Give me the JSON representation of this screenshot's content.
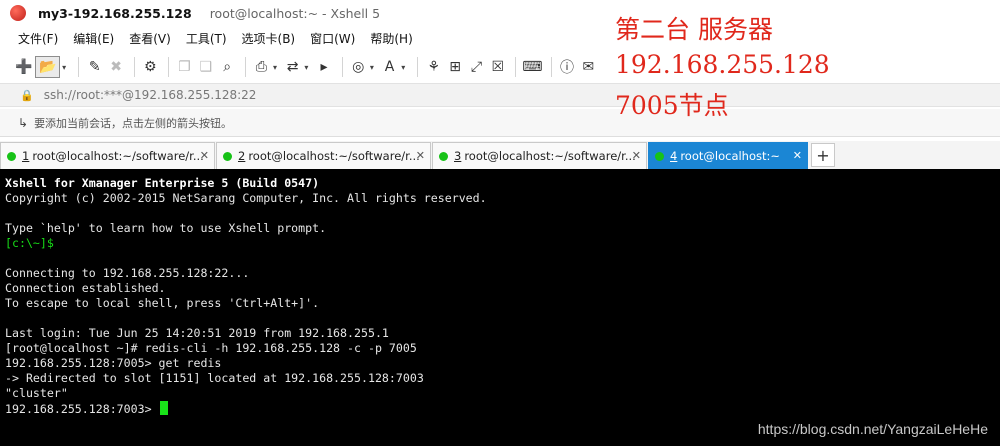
{
  "window": {
    "session_title": "my3-192.168.255.128",
    "title_rest": "root@localhost:~ - Xshell 5"
  },
  "menu": [
    "文件(F)",
    "编辑(E)",
    "查看(V)",
    "工具(T)",
    "选项卡(B)",
    "窗口(W)",
    "帮助(H)"
  ],
  "toolbar": {
    "icons": [
      "new-session-icon",
      "open-folder-icon",
      "disconnect-icon",
      "reconnect-icon",
      "properties-icon",
      "copy-icon",
      "paste-icon",
      "find-icon",
      "print-icon",
      "transfer-icon",
      "script-icon",
      "globe-icon",
      "font-icon",
      "xftp-icon",
      "tile-icon",
      "fullscreen-icon",
      "lock-icon",
      "keyboard-icon",
      "help-icon",
      "chat-icon"
    ]
  },
  "address": {
    "url": "ssh://root:***@192.168.255.128:22"
  },
  "hint": {
    "text": "要添加当前会话，点击左侧的箭头按钮。"
  },
  "tabs": [
    {
      "num": "1",
      "label": "root@localhost:~/software/r...",
      "active": false
    },
    {
      "num": "2",
      "label": "root@localhost:~/software/r...",
      "active": false
    },
    {
      "num": "3",
      "label": "root@localhost:~/software/r...",
      "active": false
    },
    {
      "num": "4",
      "label": "root@localhost:~",
      "active": true
    }
  ],
  "terminal": {
    "lines": [
      {
        "text": "Xshell for Xmanager Enterprise 5 (Build 0547)",
        "style": "bold"
      },
      {
        "text": "Copyright (c) 2002-2015 NetSarang Computer, Inc. All rights reserved.",
        "style": ""
      },
      {
        "text": "",
        "style": ""
      },
      {
        "text": "Type `help' to learn how to use Xshell prompt.",
        "style": ""
      },
      {
        "text": "[c:\\~]$",
        "style": "green"
      },
      {
        "text": "",
        "style": ""
      },
      {
        "text": "Connecting to 192.168.255.128:22...",
        "style": ""
      },
      {
        "text": "Connection established.",
        "style": ""
      },
      {
        "text": "To escape to local shell, press 'Ctrl+Alt+]'.",
        "style": ""
      },
      {
        "text": "",
        "style": ""
      },
      {
        "text": "Last login: Tue Jun 25 14:20:51 2019 from 192.168.255.1",
        "style": ""
      },
      {
        "text": "[root@localhost ~]# redis-cli -h 192.168.255.128 -c -p 7005",
        "style": ""
      },
      {
        "text": "192.168.255.128:7005> get redis",
        "style": ""
      },
      {
        "text": "-> Redirected to slot [1151] located at 192.168.255.128:7003",
        "style": ""
      },
      {
        "text": "\"cluster\"",
        "style": ""
      }
    ],
    "prompt": "192.168.255.128:7003> "
  },
  "annotation": {
    "line1": "第二台 服务器",
    "line2": "192.168.255.128",
    "line3": "7005节点"
  },
  "watermark": "https://blog.csdn.net/YangzaiLeHeHe",
  "colors": {
    "annotation_red": "#e0281c",
    "active_tab_blue": "#1b86d4",
    "status_dot_green": "#17c217",
    "terminal_bg": "#000000",
    "cursor_green": "#19e319"
  }
}
